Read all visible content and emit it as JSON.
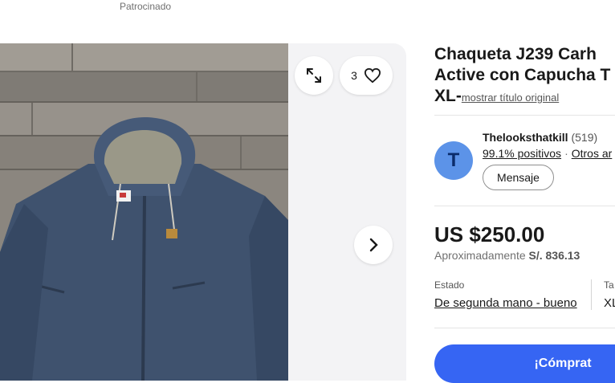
{
  "header": {
    "sponsored": "Patrocinado"
  },
  "gallery": {
    "watch_count": "3",
    "image_alt": "Chaqueta denim con capucha"
  },
  "listing": {
    "title_line1": "Chaqueta J239 Carh",
    "title_line2": "Active con Capucha T",
    "title_line3": "XL-",
    "show_original": "mostrar título original"
  },
  "seller": {
    "initial": "T",
    "name": "Thelooksthatkill",
    "count": "(519)",
    "positive": "99.1% positivos",
    "separator": "·",
    "other": "Otros ar",
    "message": "Mensaje"
  },
  "price": {
    "main": "US $250.00",
    "approx_label": "Aproximadamente",
    "approx_value": "S/. 836.13"
  },
  "condition": {
    "label": "Estado",
    "value": "De segunda mano - bueno",
    "size_label": "Ta",
    "size_value": "XL"
  },
  "actions": {
    "buy_now": "¡Cómprat"
  },
  "colors": {
    "accent": "#3665f3",
    "avatar": "#5c93e8"
  }
}
